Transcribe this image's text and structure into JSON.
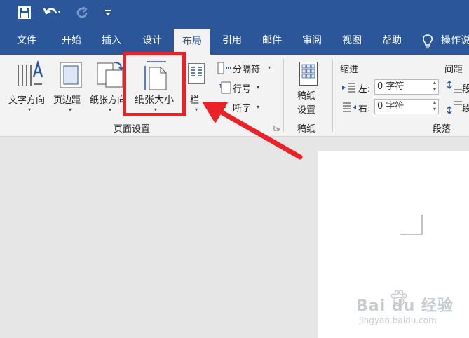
{
  "qat": {
    "save_icon": "save-icon",
    "undo_icon": "undo-icon",
    "redo_icon": "redo-icon",
    "customize_icon": "customize-qat-icon"
  },
  "tabs": [
    "文件",
    "开始",
    "插入",
    "设计",
    "布局",
    "引用",
    "邮件",
    "审阅",
    "视图",
    "帮助"
  ],
  "active_tab": "布局",
  "tell_me": "操作说",
  "page_setup": {
    "group_label": "页面设置",
    "text_direction": "文字方向",
    "margins": "页边距",
    "orientation": "纸张方向",
    "size": "纸张大小",
    "columns": "栏",
    "breaks": "分隔符",
    "line_numbers": "行号",
    "hyphenation": "断字"
  },
  "manuscript": {
    "label_line1": "稿纸",
    "label_line2": "设置",
    "group_label": "稿纸"
  },
  "paragraph": {
    "indent_label": "缩进",
    "spacing_label": "间距",
    "left_label": "左:",
    "left_value": "0 字符",
    "right_label": "右:",
    "right_value": "0 字符",
    "before_label": "段",
    "after_label": "段",
    "group_label": "段落"
  },
  "colors": {
    "brand": "#2b579a",
    "highlight": "#ec2127"
  },
  "watermark": {
    "text": "Bai du 经验",
    "sub": "jingyan.baidu.com"
  }
}
